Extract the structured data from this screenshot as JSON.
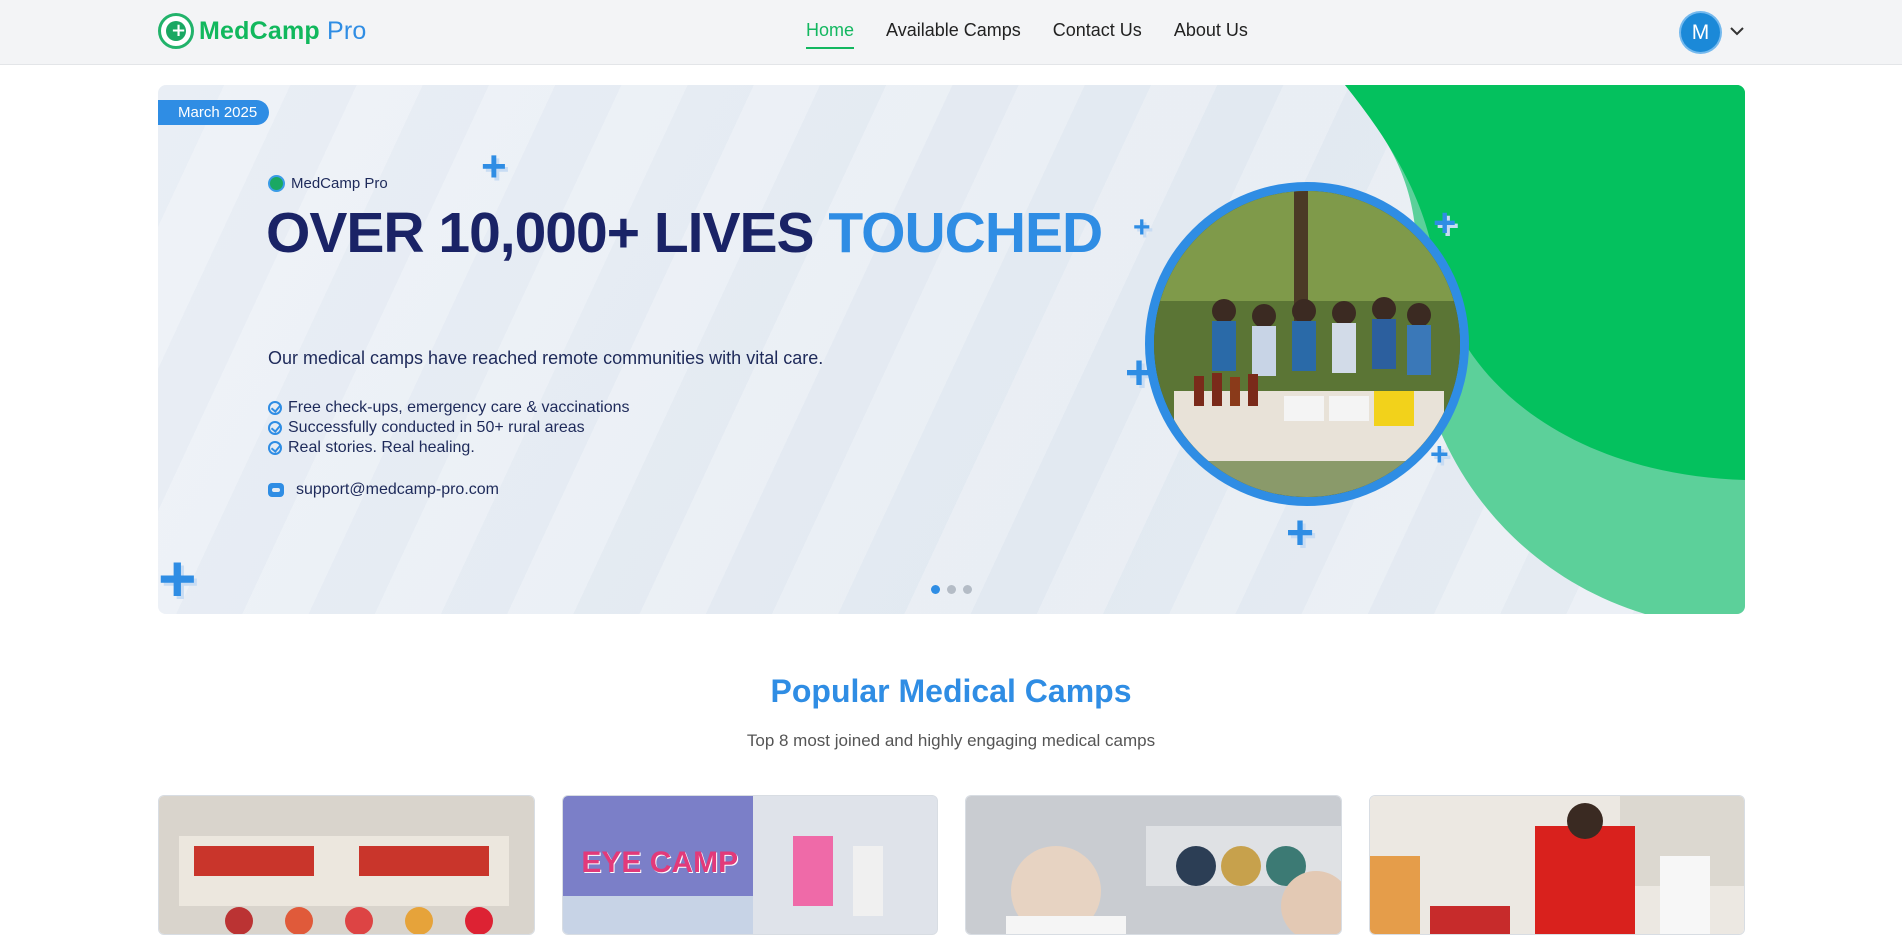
{
  "brand": {
    "name_main": "MedCamp",
    "name_accent": " Pro"
  },
  "nav": {
    "items": [
      {
        "label": "Home",
        "active": true
      },
      {
        "label": "Available Camps",
        "active": false
      },
      {
        "label": "Contact Us",
        "active": false
      },
      {
        "label": "About Us",
        "active": false
      }
    ]
  },
  "user": {
    "initial": "M"
  },
  "hero": {
    "date_badge": "March 2025",
    "brand_label": "MedCamp Pro",
    "title_main": "OVER 10,000+ LIVES ",
    "title_highlight": "TOUCHED",
    "subtitle": "Our medical camps have reached remote communities with vital care.",
    "bullets": [
      "Free check-ups, emergency care & vaccinations",
      "Successfully conducted in 50+ rural areas",
      "Real stories. Real healing."
    ],
    "email": "support@medcamp-pro.com",
    "slide_count": 3,
    "active_slide": 1
  },
  "popular": {
    "title": "Popular Medical Camps",
    "subtitle": "Top 8 most joined and highly engaging medical camps"
  },
  "cards": [
    {
      "photo_text": ""
    },
    {
      "photo_text": "EYE CAMP"
    },
    {
      "photo_text": ""
    },
    {
      "photo_text": ""
    }
  ],
  "colors": {
    "brand_green": "#13b760",
    "brand_blue": "#2f8de4",
    "navy": "#1a2366"
  }
}
